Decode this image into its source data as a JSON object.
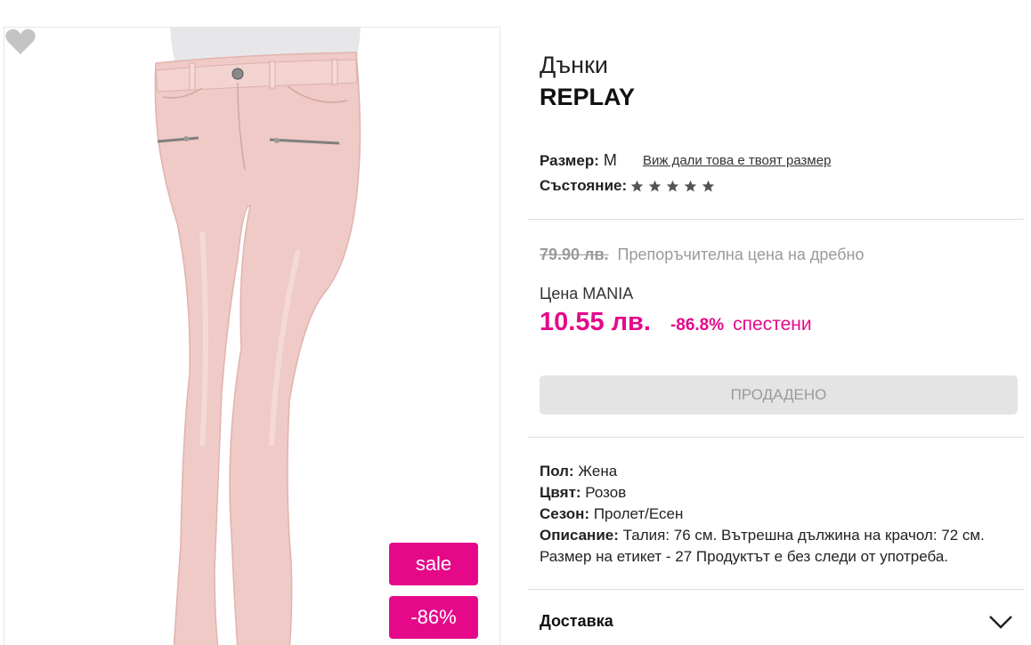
{
  "product": {
    "category": "Дънки",
    "brand": "REPLAY",
    "image_alt": "pink skinny jeans on mannequin"
  },
  "badges": {
    "sale": "sale",
    "discount": "-86%"
  },
  "size": {
    "label": "Размер:",
    "value": "M",
    "link": "Виж дали това е твоят размер"
  },
  "condition": {
    "label": "Състояние:",
    "stars": 5
  },
  "pricing": {
    "old_price": "79.90 лв.",
    "old_price_note": "Препоръчителна цена на дребно",
    "mania_label": "Цена MANIA",
    "price": "10.55 лв.",
    "discount_pct": "-86.8%",
    "saved_label": "спестени"
  },
  "actions": {
    "sold_label": "ПРОДАДЕНО"
  },
  "attributes": {
    "gender_label": "Пол:",
    "gender_value": "Жена",
    "color_label": "Цвят:",
    "color_value": "Розов",
    "season_label": "Сезон:",
    "season_value": "Пролет/Есен",
    "description_label": "Описание:",
    "description_value": "Талия: 76 см. Вътрешна дължина на крачол: 72 см. Размер на етикет - 27 Продуктът е без следи от употреба."
  },
  "delivery": {
    "label": "Доставка"
  },
  "icons": {
    "favorite": "heart-icon",
    "star": "star-icon",
    "expand": "chevron-down-icon"
  },
  "colors": {
    "accent": "#e5098a",
    "jeans": "#efc9c6",
    "star": "#555555"
  }
}
